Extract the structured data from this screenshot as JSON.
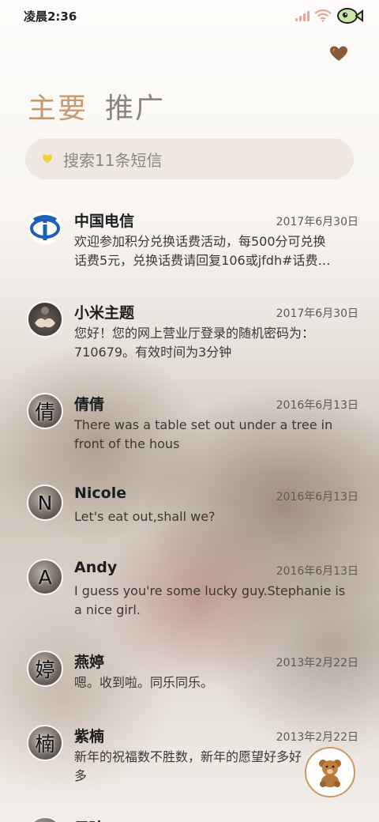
{
  "status_bar": {
    "time": "凌晨2:36"
  },
  "tabs": [
    {
      "label": "主要"
    },
    {
      "label": "推广"
    }
  ],
  "search": {
    "placeholder": "搜索11条短信"
  },
  "messages": [
    {
      "name": "中国电信",
      "date": "2017年6月30日",
      "preview": "欢迎参加积分兑换话费活动，每500分可兑换\n话费5元，兑换话费请回复106或jfdh#话费…",
      "avatar": {
        "type": "telecom-logo"
      }
    },
    {
      "name": "小米主题",
      "date": "2017年6月30日",
      "preview": "您好！您的网上营业厅登录的随机密码为：\n710679。有效时间为3分钟",
      "avatar": {
        "type": "photo"
      }
    },
    {
      "name": "倩倩",
      "date": "2016年6月13日",
      "preview": "There was a table set out under a tree in\nfront of the hous",
      "avatar": {
        "type": "letter",
        "letter": "倩"
      }
    },
    {
      "name": "Nicole",
      "date": "2016年6月13日",
      "preview": "Let's eat out,shall we?",
      "avatar": {
        "type": "letter",
        "letter": "N"
      }
    },
    {
      "name": "Andy",
      "date": "2016年6月13日",
      "preview": "I guess you're some lucky guy.Stephanie is\na nice girl.",
      "avatar": {
        "type": "letter",
        "letter": "A"
      }
    },
    {
      "name": "燕婷",
      "date": "2013年2月22日",
      "preview": "嗯。收到啦。同乐同乐。",
      "avatar": {
        "type": "letter",
        "letter": "婷"
      }
    },
    {
      "name": "紫楠",
      "date": "2013年2月22日",
      "preview": "新年的祝福数不胜数，新年的愿望好多好多\n新年的问候依旧美好，在这个温馨的时刻",
      "avatar": {
        "type": "letter",
        "letter": "楠"
      }
    },
    {
      "name": "子玲",
      "date": "",
      "preview": "",
      "avatar": {
        "type": "letter",
        "letter": "婷"
      }
    }
  ],
  "icons": {
    "heart": "heart-icon",
    "search": "heart-small-icon",
    "fab": "teddy-bear-icon",
    "status": [
      "signal-icon",
      "wifi-icon",
      "fish-icon"
    ]
  },
  "colors": {
    "active_tab": "#c79b6f",
    "inactive_tab": "#8a8580",
    "fab_border": "#c89a63",
    "heart": "#8a5a38"
  }
}
